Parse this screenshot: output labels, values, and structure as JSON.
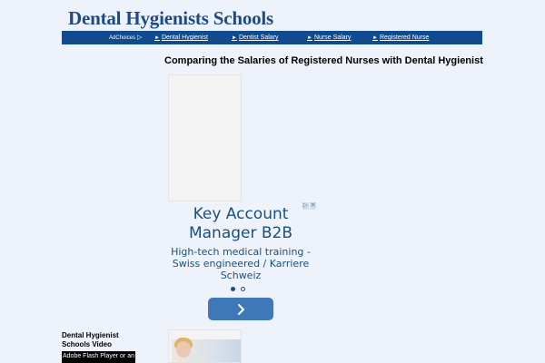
{
  "header": {
    "site_title": "Dental Hygienists Schools"
  },
  "navbar": {
    "adchoices": "AdChoices",
    "links": [
      {
        "label": "Dental Hygienist"
      },
      {
        "label": "Dentist Salary"
      },
      {
        "label": "Nurse Salary"
      },
      {
        "label": "Registered Nurse"
      }
    ]
  },
  "main": {
    "heading": "Comparing the Salaries of Registered Nurses with Dental Hygienist"
  },
  "ad": {
    "title": "Key Account Manager B2B",
    "description": "High-tech medical training - Swiss engineered / Karriere Schweiz",
    "close_glyphs": [
      "▷",
      "✕"
    ]
  },
  "sidebar": {
    "video_heading": "Dental Hygienist Schools Video",
    "flash_notice": "Adobe Flash Player or an"
  },
  "colors": {
    "brand": "#1d4a86",
    "navbar": "#0f4b8d",
    "ad_text": "#1c4f7a",
    "ad_button": "#3f78b8",
    "page_bg": "#eef3fb"
  }
}
